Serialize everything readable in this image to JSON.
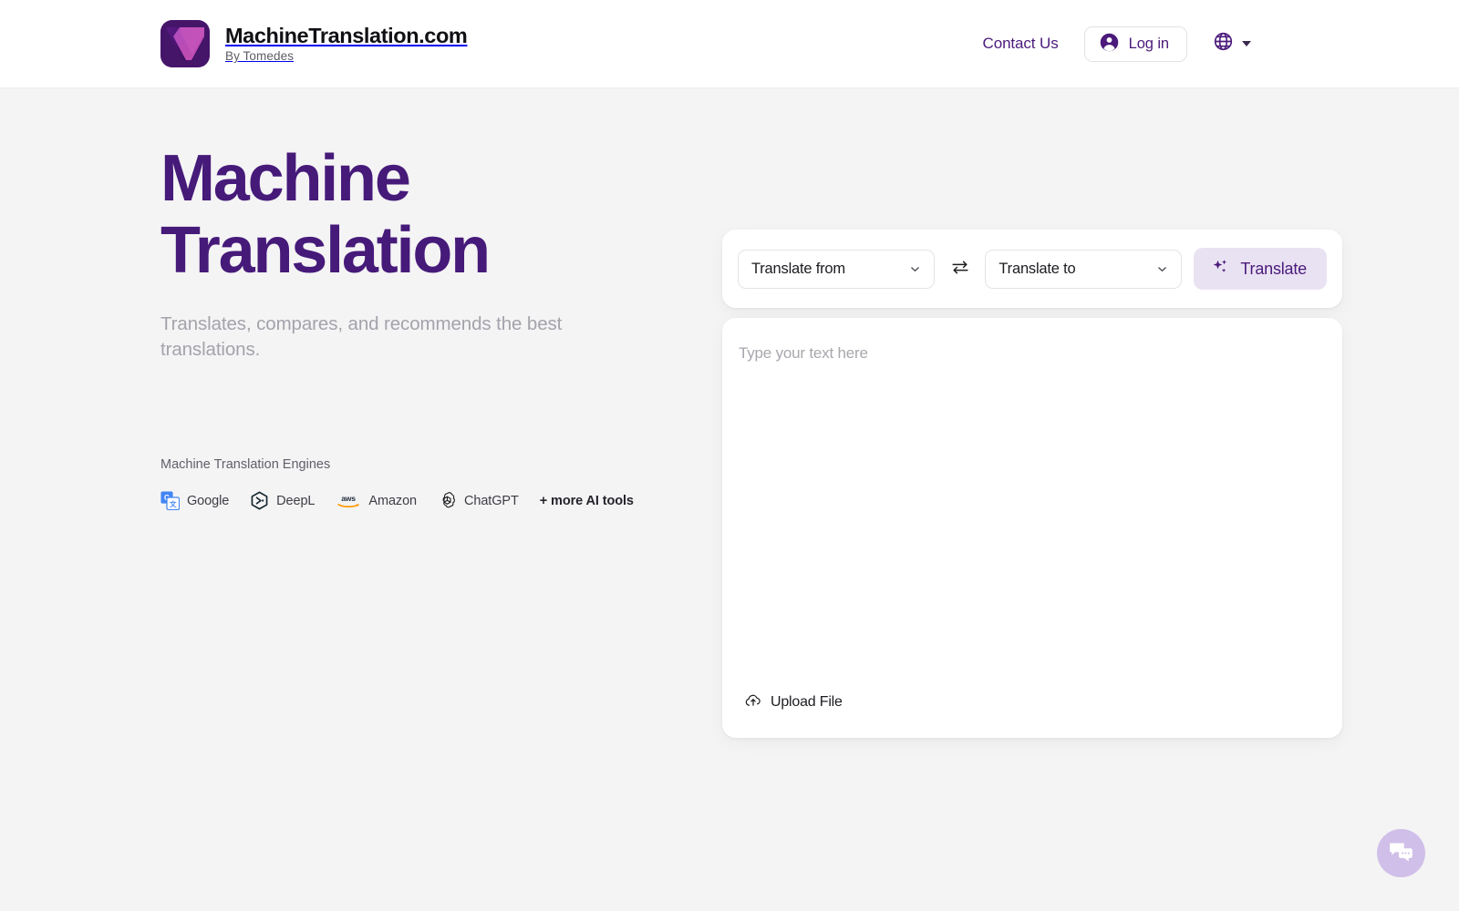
{
  "header": {
    "logo_icon": "machinetranslation-butterfly-logo",
    "brand_title": "MachineTranslation.com",
    "brand_subtitle": "By Tomedes",
    "contact_label": "Contact Us",
    "login_label": "Log in",
    "login_icon": "account-circle-icon",
    "language_icon": "globe-icon",
    "language_caret_icon": "caret-down-icon"
  },
  "hero": {
    "title_line_1": "Machine",
    "title_line_2": "Translation",
    "subtitle": "Translates, compares, and recommends the best translations.",
    "engines_label": "Machine Translation Engines",
    "engines": [
      {
        "name": "Google",
        "icon": "google-translate-icon"
      },
      {
        "name": "DeepL",
        "icon": "deepl-icon"
      },
      {
        "name": "Amazon",
        "icon": "aws-icon"
      },
      {
        "name": "ChatGPT",
        "icon": "openai-icon"
      }
    ],
    "more_tools_label": "+ more AI tools"
  },
  "translator": {
    "source_language": "Translate from",
    "target_language": "Translate to",
    "swap_icon": "swap-horizontal-icon",
    "chevron_icon": "chevron-down-icon",
    "translate_label": "Translate",
    "translate_icon": "sparkles-icon",
    "input_value": "",
    "input_placeholder": "Type your text here",
    "upload_label": "Upload File",
    "upload_icon": "cloud-upload-icon"
  },
  "chat": {
    "icon": "chat-bubbles-icon"
  },
  "colors": {
    "brand_purple": "#461a79",
    "accent_lavender": "#e9e2f3",
    "page_background": "#f4f4f5",
    "chat_bubble": "#cfbfe9"
  }
}
